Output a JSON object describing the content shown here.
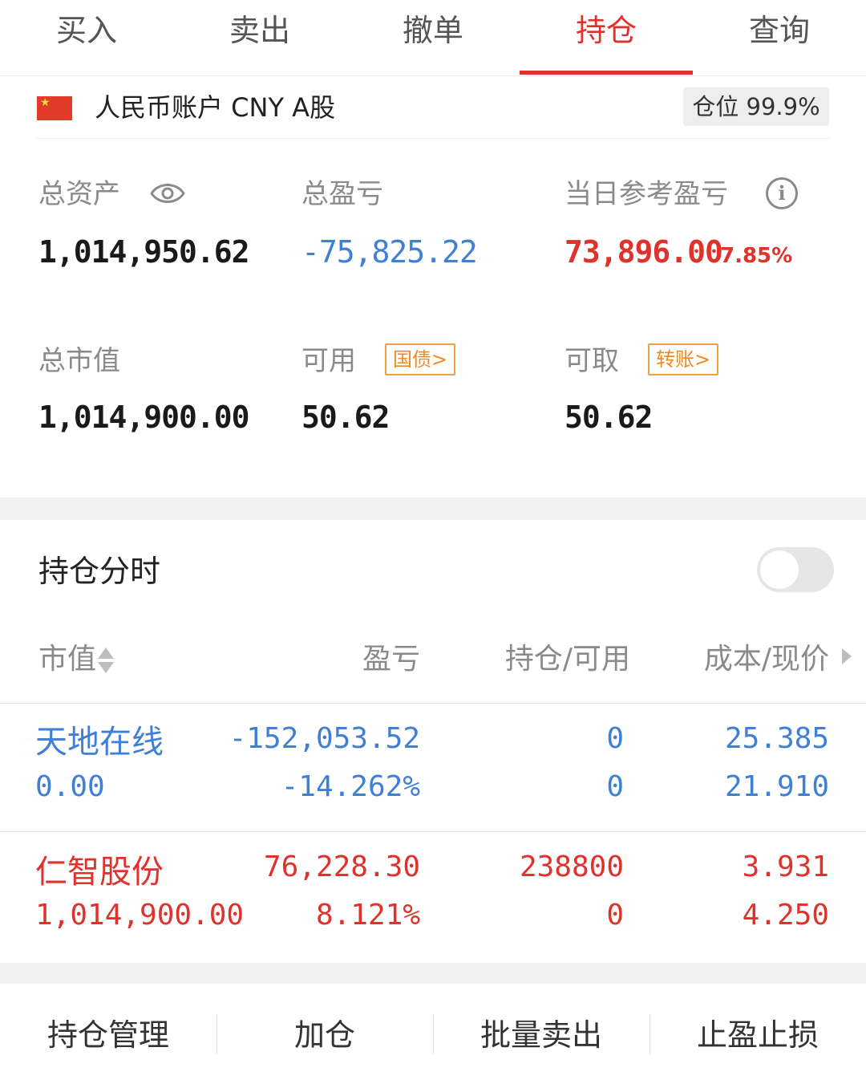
{
  "tabs": [
    {
      "label": "买入",
      "active": false
    },
    {
      "label": "卖出",
      "active": false
    },
    {
      "label": "撤单",
      "active": false
    },
    {
      "label": "持仓",
      "active": true
    },
    {
      "label": "查询",
      "active": false
    }
  ],
  "account": {
    "name": "人民币账户 CNY A股",
    "position_badge": "仓位 99.9%"
  },
  "summary": {
    "total_assets": {
      "label": "总资产",
      "value": "1,014,950.62"
    },
    "total_pnl": {
      "label": "总盈亏",
      "value": "-75,825.22"
    },
    "daily_pnl": {
      "label": "当日参考盈亏",
      "value": "73,896.00",
      "pct": "7.85%"
    },
    "market_value": {
      "label": "总市值",
      "value": "1,014,900.00"
    },
    "available": {
      "label": "可用",
      "value": "50.62",
      "tag": "国债>"
    },
    "withdrawable": {
      "label": "可取",
      "value": "50.62",
      "tag": "转账>"
    }
  },
  "holdings": {
    "title": "持仓分时",
    "toggle_on": false,
    "columns": [
      "市值",
      "盈亏",
      "持仓/可用",
      "成本/现价"
    ],
    "rows": [
      {
        "name": "天地在线",
        "market_value": "0.00",
        "pnl": "-152,053.52",
        "pnl_pct": "-14.262%",
        "position": "0",
        "available": "0",
        "cost": "25.385",
        "price": "21.910",
        "color": "#3f7fd6"
      },
      {
        "name": "仁智股份",
        "market_value": "1,014,900.00",
        "pnl": "76,228.30",
        "pnl_pct": "8.121%",
        "position": "238800",
        "available": "0",
        "cost": "3.931",
        "price": "4.250",
        "color": "#e0322d"
      }
    ]
  },
  "bottom_actions": [
    "持仓管理",
    "加仓",
    "批量卖出",
    "止盈止损"
  ],
  "colors": {
    "accent": "#e0322d",
    "loss": "#3f7fd6",
    "tag": "#f08a1c"
  }
}
